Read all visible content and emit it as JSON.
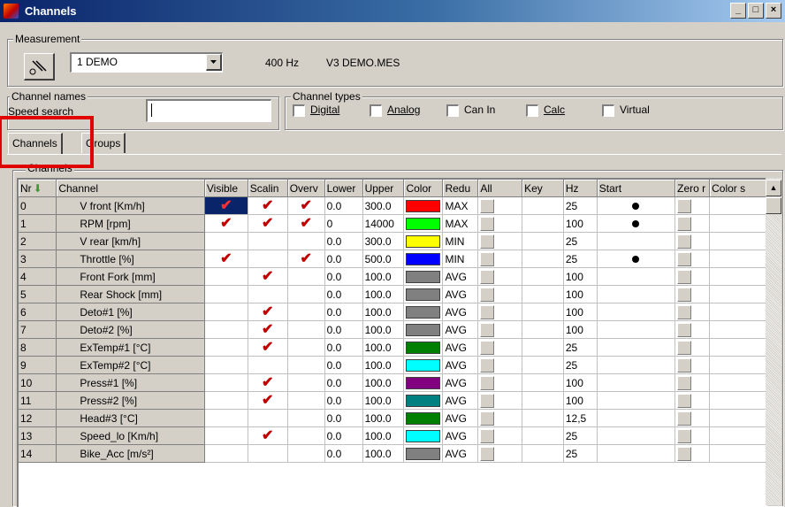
{
  "window": {
    "title": "Channels",
    "min": "_",
    "max": "□",
    "close": "×"
  },
  "measurement": {
    "legend": "Measurement",
    "selected": "1 DEMO",
    "rate": "400 Hz",
    "file": "V3  DEMO.MES"
  },
  "channel_names": {
    "legend": "Channel names",
    "search_label": "Speed search",
    "search_value": ""
  },
  "channel_types": {
    "legend": "Channel types",
    "options": [
      {
        "label": "Digital",
        "checked": false
      },
      {
        "label": "Analog",
        "checked": false
      },
      {
        "label": "Can In",
        "checked": false
      },
      {
        "label": "Calc",
        "checked": false
      },
      {
        "label": "Virtual",
        "checked": false
      }
    ]
  },
  "tabs": [
    {
      "label": "Channels"
    },
    {
      "label": "Groups"
    }
  ],
  "panel_legend": "Channels",
  "table": {
    "columns": [
      "Nr",
      "Channel",
      "Visible",
      "Scalin",
      "Overv",
      "Lower",
      "Upper",
      "Color",
      "Redu",
      "All",
      "Key",
      "Hz",
      "Start",
      "Zero r",
      "Color s"
    ],
    "rows": [
      {
        "nr": "0",
        "name": "V front [Km/h]",
        "visible": true,
        "scaling": true,
        "overview": true,
        "lower": "0.0",
        "upper": "300.0",
        "color": "#ff0000",
        "redu": "MAX",
        "hz": "25",
        "start": true
      },
      {
        "nr": "1",
        "name": "RPM [rpm]",
        "visible": true,
        "scaling": true,
        "overview": true,
        "lower": "0",
        "upper": "14000",
        "color": "#00ff00",
        "redu": "MAX",
        "hz": "100",
        "start": true
      },
      {
        "nr": "2",
        "name": "V rear [km/h]",
        "visible": false,
        "scaling": false,
        "overview": false,
        "lower": "0.0",
        "upper": "300.0",
        "color": "#ffff00",
        "redu": "MIN",
        "hz": "25",
        "start": false
      },
      {
        "nr": "3",
        "name": "Throttle [%]",
        "visible": true,
        "scaling": false,
        "overview": true,
        "lower": "0.0",
        "upper": "500.0",
        "color": "#0000ff",
        "redu": "MIN",
        "hz": "25",
        "start": true
      },
      {
        "nr": "4",
        "name": "Front Fork [mm]",
        "visible": false,
        "scaling": true,
        "overview": false,
        "lower": "0.0",
        "upper": "100.0",
        "color": "#808080",
        "redu": "AVG",
        "hz": "100",
        "start": false
      },
      {
        "nr": "5",
        "name": "Rear Shock [mm]",
        "visible": false,
        "scaling": false,
        "overview": false,
        "lower": "0.0",
        "upper": "100.0",
        "color": "#808080",
        "redu": "AVG",
        "hz": "100",
        "start": false
      },
      {
        "nr": "6",
        "name": "Deto#1 [%]",
        "visible": false,
        "scaling": true,
        "overview": false,
        "lower": "0.0",
        "upper": "100.0",
        "color": "#808080",
        "redu": "AVG",
        "hz": "100",
        "start": false
      },
      {
        "nr": "7",
        "name": "Deto#2 [%]",
        "visible": false,
        "scaling": true,
        "overview": false,
        "lower": "0.0",
        "upper": "100.0",
        "color": "#808080",
        "redu": "AVG",
        "hz": "100",
        "start": false
      },
      {
        "nr": "8",
        "name": "ExTemp#1 [°C]",
        "visible": false,
        "scaling": true,
        "overview": false,
        "lower": "0.0",
        "upper": "100.0",
        "color": "#008000",
        "redu": "AVG",
        "hz": "25",
        "start": false
      },
      {
        "nr": "9",
        "name": "ExTemp#2 [°C]",
        "visible": false,
        "scaling": false,
        "overview": false,
        "lower": "0.0",
        "upper": "100.0",
        "color": "#00ffff",
        "redu": "AVG",
        "hz": "25",
        "start": false
      },
      {
        "nr": "10",
        "name": "Press#1 [%]",
        "visible": false,
        "scaling": true,
        "overview": false,
        "lower": "0.0",
        "upper": "100.0",
        "color": "#800080",
        "redu": "AVG",
        "hz": "100",
        "start": false
      },
      {
        "nr": "11",
        "name": "Press#2 [%]",
        "visible": false,
        "scaling": true,
        "overview": false,
        "lower": "0.0",
        "upper": "100.0",
        "color": "#008080",
        "redu": "AVG",
        "hz": "100",
        "start": false
      },
      {
        "nr": "12",
        "name": "Head#3 [°C]",
        "visible": false,
        "scaling": false,
        "overview": false,
        "lower": "0.0",
        "upper": "100.0",
        "color": "#008000",
        "redu": "AVG",
        "hz": "12,5",
        "start": false
      },
      {
        "nr": "13",
        "name": "Speed_lo [Km/h]",
        "visible": false,
        "scaling": true,
        "overview": false,
        "lower": "0.0",
        "upper": "100.0",
        "color": "#00ffff",
        "redu": "AVG",
        "hz": "25",
        "start": false
      },
      {
        "nr": "14",
        "name": "Bike_Acc [m/s²]",
        "visible": false,
        "scaling": false,
        "overview": false,
        "lower": "0.0",
        "upper": "100.0",
        "color": "#808080",
        "redu": "AVG",
        "hz": "25",
        "start": false
      }
    ]
  },
  "icons": {
    "checkmark": "check-icon",
    "start": "dot-icon",
    "sort": "down-arrow-icon",
    "probe": "probe-icon"
  },
  "accent_colors": {
    "titlebar": "#0a246a",
    "highlight": "#e00000"
  }
}
